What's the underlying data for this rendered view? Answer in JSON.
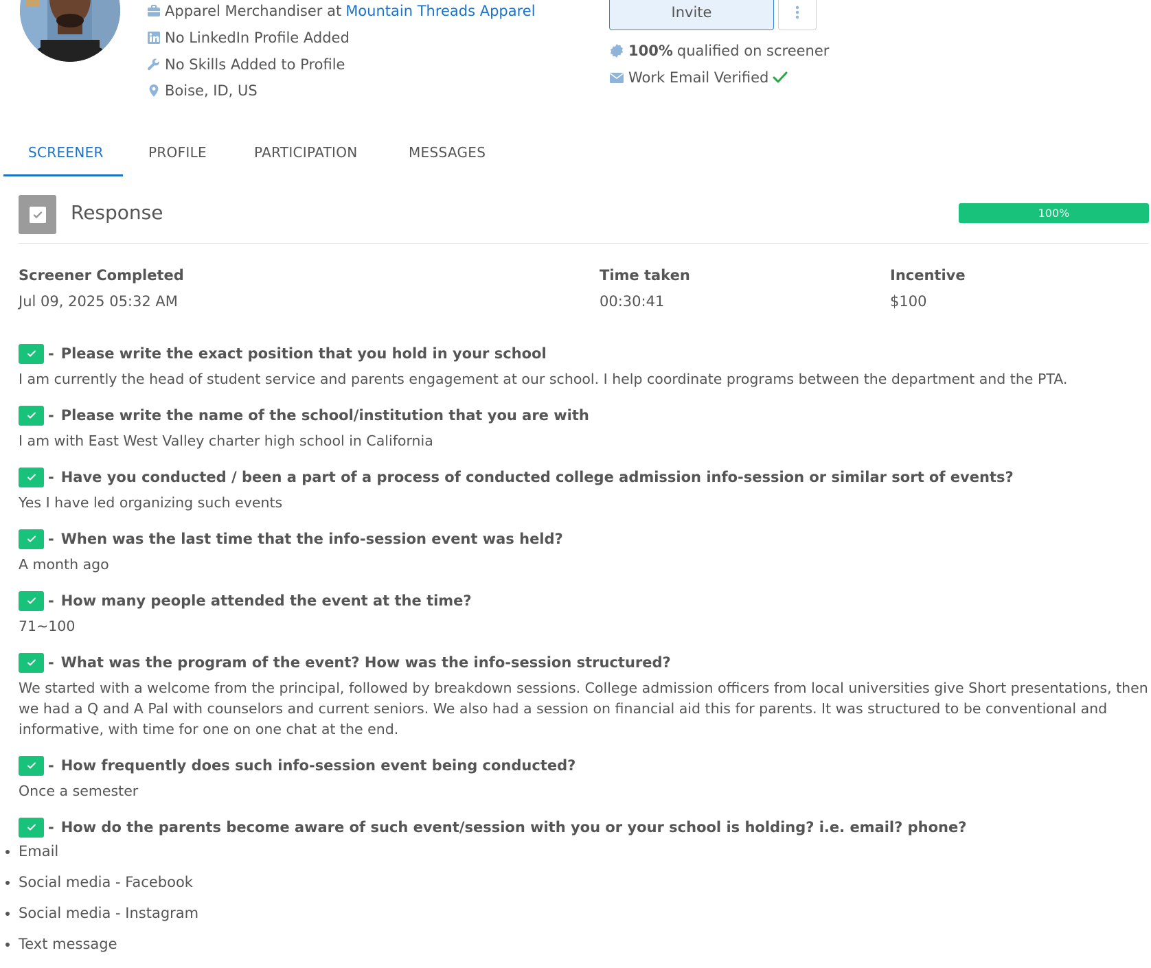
{
  "profile": {
    "job_prefix": "Apparel Merchandiser at",
    "company": "Mountain Threads Apparel",
    "linkedin": "No LinkedIn Profile Added",
    "skills": "No Skills Added to Profile",
    "location": "Boise, ID, US",
    "icons": [
      "briefcase-icon",
      "linkedin-icon",
      "wrench-icon",
      "map-pin-icon"
    ]
  },
  "actions": {
    "invite_label": "Invite",
    "more_icon": "vertical-ellipsis-icon"
  },
  "meta": {
    "qualified_percent": "100%",
    "qualified_text": "qualified on screener",
    "email_verified": "Work Email Verified"
  },
  "tabs": [
    {
      "label": "SCREENER",
      "active": true
    },
    {
      "label": "PROFILE",
      "active": false
    },
    {
      "label": "PARTICIPATION",
      "active": false
    },
    {
      "label": "MESSAGES",
      "active": false
    }
  ],
  "response": {
    "title": "Response",
    "progress_label": "100%",
    "progress_value": 1.0
  },
  "stats": {
    "completed_label": "Screener Completed",
    "completed_value": "Jul 09, 2025 05:32 AM",
    "time_label": "Time taken",
    "time_value": "00:30:41",
    "incentive_label": "Incentive",
    "incentive_value": "$100"
  },
  "questions": [
    {
      "q": "Please write the exact position that you hold in your school",
      "a": "I am currently the head of student service and parents engagement at our school. I help coordinate programs between the department and the PTA."
    },
    {
      "q": "Please write the name of the school/institution that you are with",
      "a": "I am with East West Valley charter high school in California"
    },
    {
      "q": "Have you conducted / been a part of a process of conducted college admission info-session or similar sort of events?",
      "a": "Yes I have led organizing such events"
    },
    {
      "q": "When was the last time that the info-session event was held?",
      "a": "A month ago"
    },
    {
      "q": "How many people attended the event at the time?",
      "a": "71~100"
    },
    {
      "q": "What was the program of the event? How was the info-session structured?",
      "a": "We started with a welcome from the principal, followed by breakdown sessions. College admission officers from local universities give Short presentations, then we had a Q and A Pal with counselors and current seniors. We also had a session on financial aid this for parents. It was structured to be conventional and informative, with time for one on one chat at the end."
    },
    {
      "q": "How frequently does such info-session event being conducted?",
      "a": "Once a semester"
    },
    {
      "q": "How do the parents become aware of such event/session with you or your school is holding? i.e. email? phone?",
      "a": ""
    }
  ],
  "last_answer_items": [
    "Email",
    "Social media - Facebook",
    "Social media - Instagram",
    "Text message"
  ],
  "colors": {
    "accent_blue": "#1a73c8",
    "success_green": "#19c27a",
    "icon_blue": "#8fb3d9",
    "text_gray": "#555555"
  }
}
